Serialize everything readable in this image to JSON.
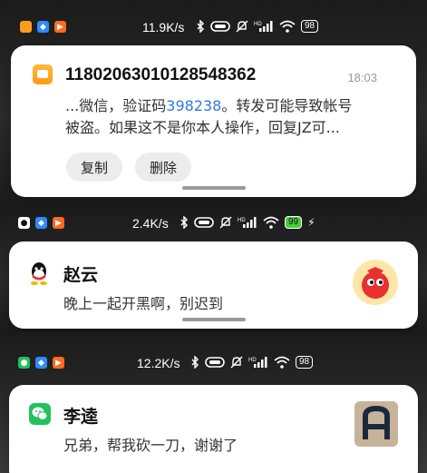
{
  "panels": [
    {
      "statusbar": {
        "speed": "11.9K/s",
        "battery": "98",
        "app_icons": [
          "message-icon",
          "bubble-icon",
          "camera-icon"
        ]
      },
      "notification": {
        "app": "sms",
        "title": "1180206301012854836​2",
        "time": "18:03",
        "body_prefix": "...微信，验证码",
        "code": "398238",
        "body_suffix": "。转发可能导致帐号",
        "body_line2": "被盗。如果这不是你本人操作，回复JZ可...",
        "actions": {
          "copy": "复制",
          "delete": "删除"
        }
      }
    },
    {
      "statusbar": {
        "speed": "2.4K/s",
        "battery": "99",
        "app_icons": [
          "qq-icon",
          "bubble-icon",
          "camera-icon"
        ]
      },
      "notification": {
        "app": "qq",
        "title": "赵云",
        "body": "晚上一起开黑啊，别迟到"
      }
    },
    {
      "statusbar": {
        "speed": "12.2K/s",
        "battery": "98",
        "app_icons": [
          "wechat-icon",
          "bubble-icon",
          "camera-icon"
        ]
      },
      "notification": {
        "app": "wechat",
        "title": "李逵",
        "body": "兄弟，帮我砍一刀，谢谢了"
      }
    }
  ],
  "colors": {
    "accent_code": "#2d7ae0",
    "sms_orange": "#ffa82a",
    "wechat_green": "#22c15e",
    "battery_charging": "#4ccc3b"
  }
}
